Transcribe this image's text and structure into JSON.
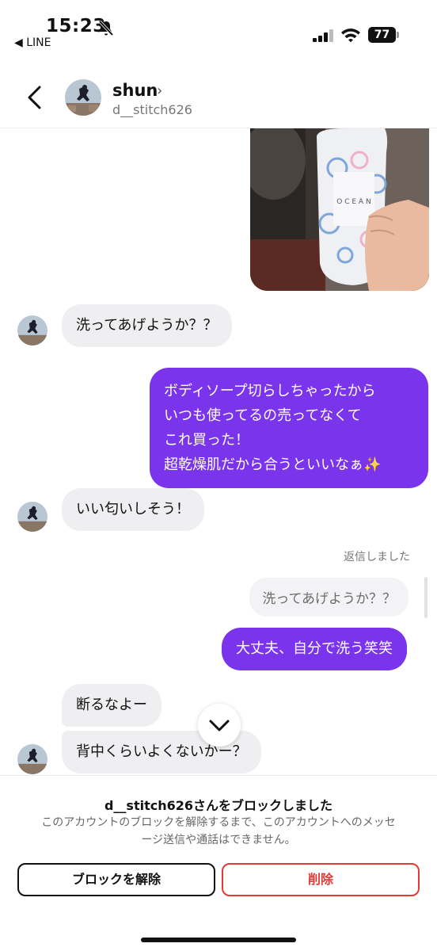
{
  "status_bar": {
    "time": "15:23",
    "back_app": "◀ LINE",
    "battery": "77"
  },
  "header": {
    "name": "shun",
    "username": "d__stitch626"
  },
  "messages": {
    "m1": "洗ってあげようか？？",
    "m2_lines": [
      "ボディソープ切らしちゃったから",
      "いつも使ってるの売ってなくて",
      "これ買った！",
      "超乾燥肌だから合うといいなぁ✨"
    ],
    "m3": "いい匂いしそう！",
    "reply_note": "返信しました",
    "reply_quote": "洗ってあげようか？？",
    "m4": "大丈夫、自分で洗う笑笑",
    "m5": "断るなよー",
    "m6": "背中くらいよくないかー？"
  },
  "block_panel": {
    "title": "d__stitch626さんをブロックしました",
    "desc_line1": "このアカウントのブロックを解除するまで、このアカウントへのメッセ",
    "desc_line2": "ージ送信や通話はできません。",
    "unblock_label": "ブロックを解除",
    "delete_label": "削除"
  },
  "colors": {
    "outgoing_bubble": "#7a34eb",
    "incoming_bubble": "#efeff1",
    "delete_red": "#e53935"
  }
}
